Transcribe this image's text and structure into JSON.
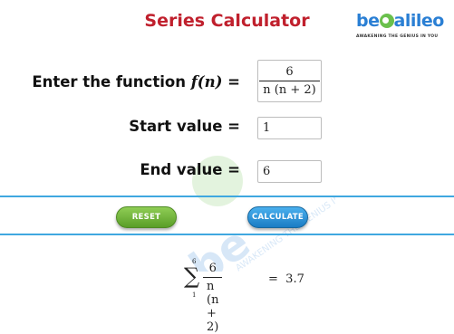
{
  "header": {
    "title": "Series Calculator"
  },
  "logo": {
    "brand_prefix": "be",
    "brand_suffix": "alileo",
    "tagline": "AWAKENING THE GENIUS IN YOU"
  },
  "form": {
    "function_label_prefix": "Enter the function ",
    "function_symbol": "f(n)",
    "function_label_suffix": " =",
    "function_numerator": "6",
    "function_denominator": "n (n + 2)",
    "start_label": "Start value =",
    "start_value": "1",
    "end_label": "End value =",
    "end_value": "6"
  },
  "buttons": {
    "reset": "RESET",
    "calculate": "CALCULATE"
  },
  "watermark": {
    "text": "AWAKENING THE GENIUS IN YOU"
  },
  "result": {
    "upper_limit": "6",
    "lower_limit": "1",
    "numerator": "6",
    "denominator": "n (n + 2)",
    "equals": "=",
    "value": "3.7"
  },
  "colors": {
    "title": "#c0202d",
    "rule": "#3fa8e0",
    "reset": "#6ab132",
    "calculate": "#2a8ad6",
    "brand": "#2a7fd4"
  }
}
